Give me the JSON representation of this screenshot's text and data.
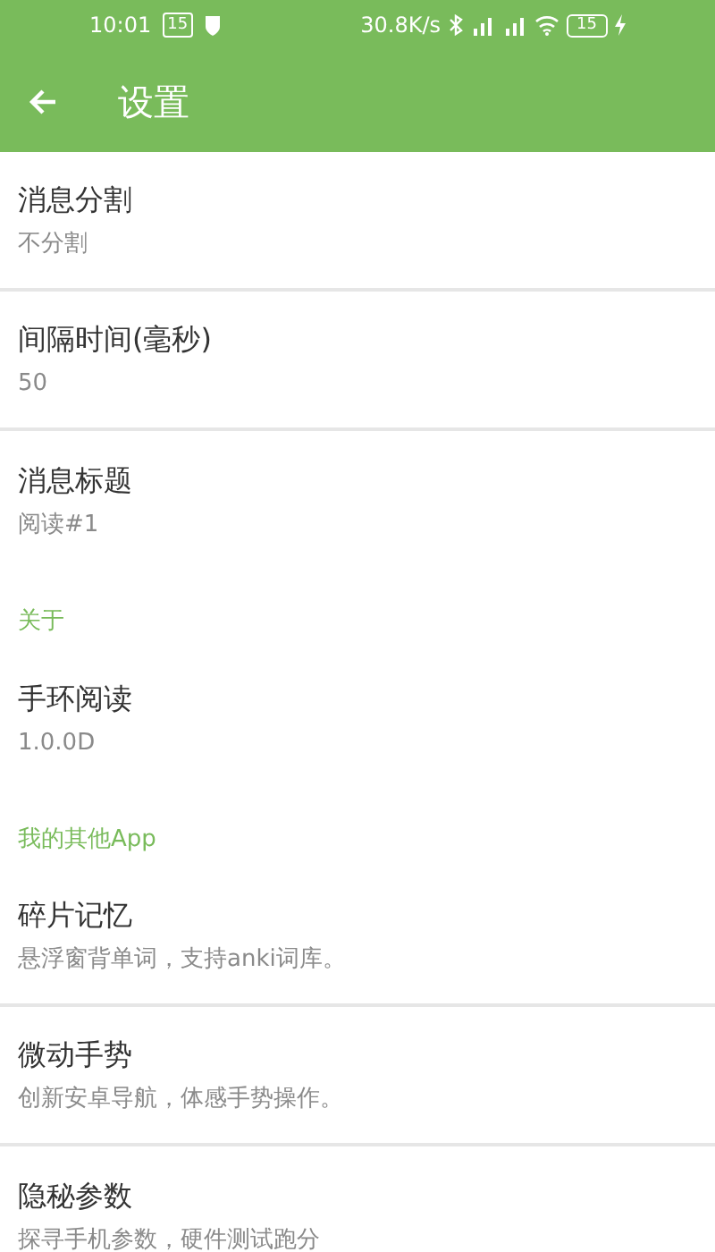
{
  "status_bar": {
    "time": "10:01",
    "notification_badge": "15",
    "network_speed": "30.8K/s",
    "battery": "15"
  },
  "toolbar": {
    "title": "设置"
  },
  "sections": [
    {
      "items": [
        {
          "title": "消息分割",
          "subtitle": "不分割"
        },
        {
          "title": "间隔时间(毫秒)",
          "subtitle": "50"
        },
        {
          "title": "消息标题",
          "subtitle": "阅读#1"
        }
      ]
    },
    {
      "header": "关于",
      "items": [
        {
          "title": "手环阅读",
          "subtitle": "1.0.0D"
        }
      ]
    },
    {
      "header": "我的其他App",
      "items": [
        {
          "title": "碎片记忆",
          "subtitle": "悬浮窗背单词，支持anki词库。"
        },
        {
          "title": "微动手势",
          "subtitle": "创新安卓导航，体感手势操作。"
        },
        {
          "title": "隐秘参数",
          "subtitle": "探寻手机参数，硬件测试跑分"
        }
      ]
    }
  ]
}
